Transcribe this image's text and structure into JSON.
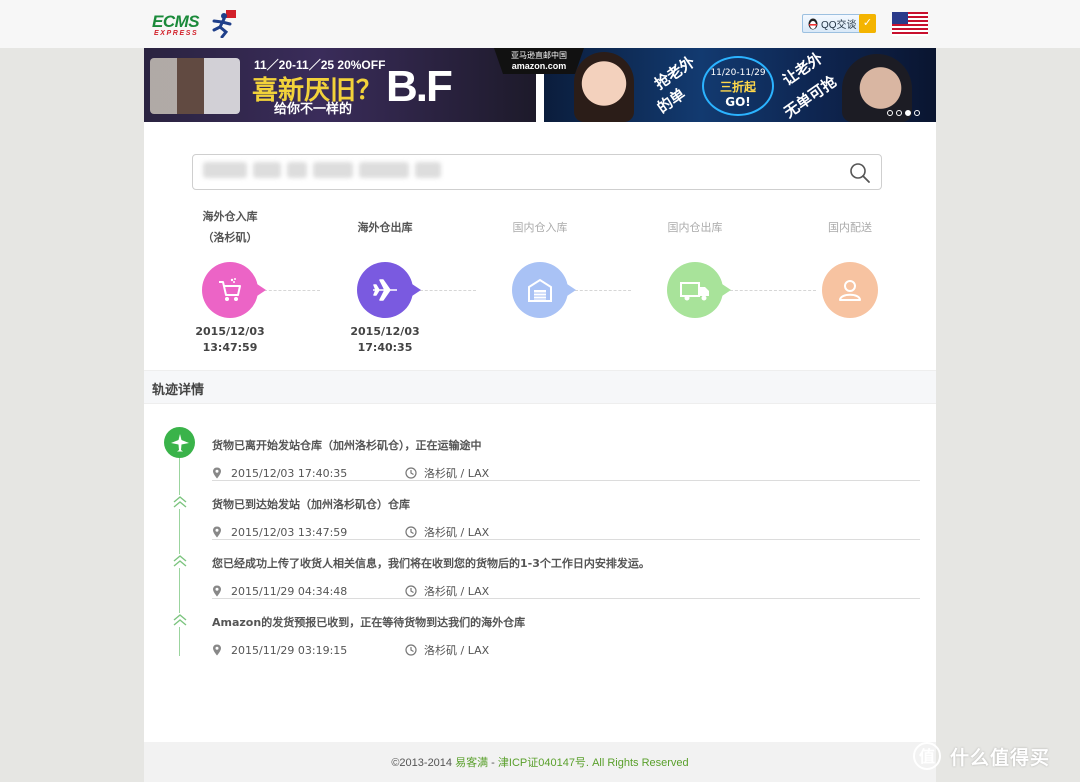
{
  "header": {
    "logo_text": "ECMS",
    "logo_sub": "EXPRESS",
    "qq_label": "QQ交谈",
    "flag": "us-flag-icon"
  },
  "banner": {
    "left_date": "11／20-11／25 20%OFF",
    "left_headline": "喜新厌旧？",
    "left_sub": "给你不一样的",
    "left_bf": "B.F",
    "amazon_label": "亚马逊直邮中国",
    "amazon_brand": "amazon.com",
    "right_text1": "抢老外",
    "right_text2": "的单",
    "right_circle_date": "11/20-11/29",
    "right_circle_discount": "三折起",
    "right_circle_go": "GO!",
    "right_text3": "让老外",
    "right_text4": "无单可抢"
  },
  "search": {
    "placeholder": ""
  },
  "steps": [
    {
      "title": "海外仓入库",
      "subtitle": "（洛杉矶）",
      "date": "2015/12/03",
      "time": "13:47:59",
      "color": "#ec64c6",
      "active": true,
      "icon": "cart-icon"
    },
    {
      "title": "海外仓出库",
      "subtitle": "",
      "date": "2015/12/03",
      "time": "17:40:35",
      "color": "#7a5ae0",
      "active": true,
      "icon": "airplane-icon"
    },
    {
      "title": "国内仓入库",
      "subtitle": "",
      "date": "",
      "time": "",
      "color": "#a9c2f5",
      "active": false,
      "icon": "warehouse-icon"
    },
    {
      "title": "国内仓出库",
      "subtitle": "",
      "date": "",
      "time": "",
      "color": "#a8e39a",
      "active": false,
      "icon": "truck-icon"
    },
    {
      "title": "国内配送",
      "subtitle": "",
      "date": "",
      "time": "",
      "color": "#f7c3a1",
      "active": false,
      "icon": "person-icon"
    }
  ],
  "details": {
    "title": "轨迹详情",
    "events": [
      {
        "title": "货物已离开始发站仓库（加州洛杉矶仓），正在运输途中",
        "time": "2015/12/03 17:40:35",
        "location": "洛杉矶 / LAX"
      },
      {
        "title": "货物已到达始发站（加州洛杉矶仓）仓库",
        "time": "2015/12/03 13:47:59",
        "location": "洛杉矶 / LAX"
      },
      {
        "title": "您已经成功上传了收货人相关信息，我们将在收到您的货物后的1-3个工作日内安排发运。",
        "time": "2015/11/29 04:34:48",
        "location": "洛杉矶 / LAX"
      },
      {
        "title": "Amazon的发货预报已收到，正在等待货物到达我们的海外仓库",
        "time": "2015/11/29 03:19:15",
        "location": "洛杉矶 / LAX"
      }
    ]
  },
  "footer": {
    "copyright": "©2013-2014",
    "company": "易客满",
    "dash": " - ",
    "icp": "津ICP证040147号.",
    "rights": "All Rights Reserved"
  },
  "watermark": {
    "text": "什么值得买"
  }
}
